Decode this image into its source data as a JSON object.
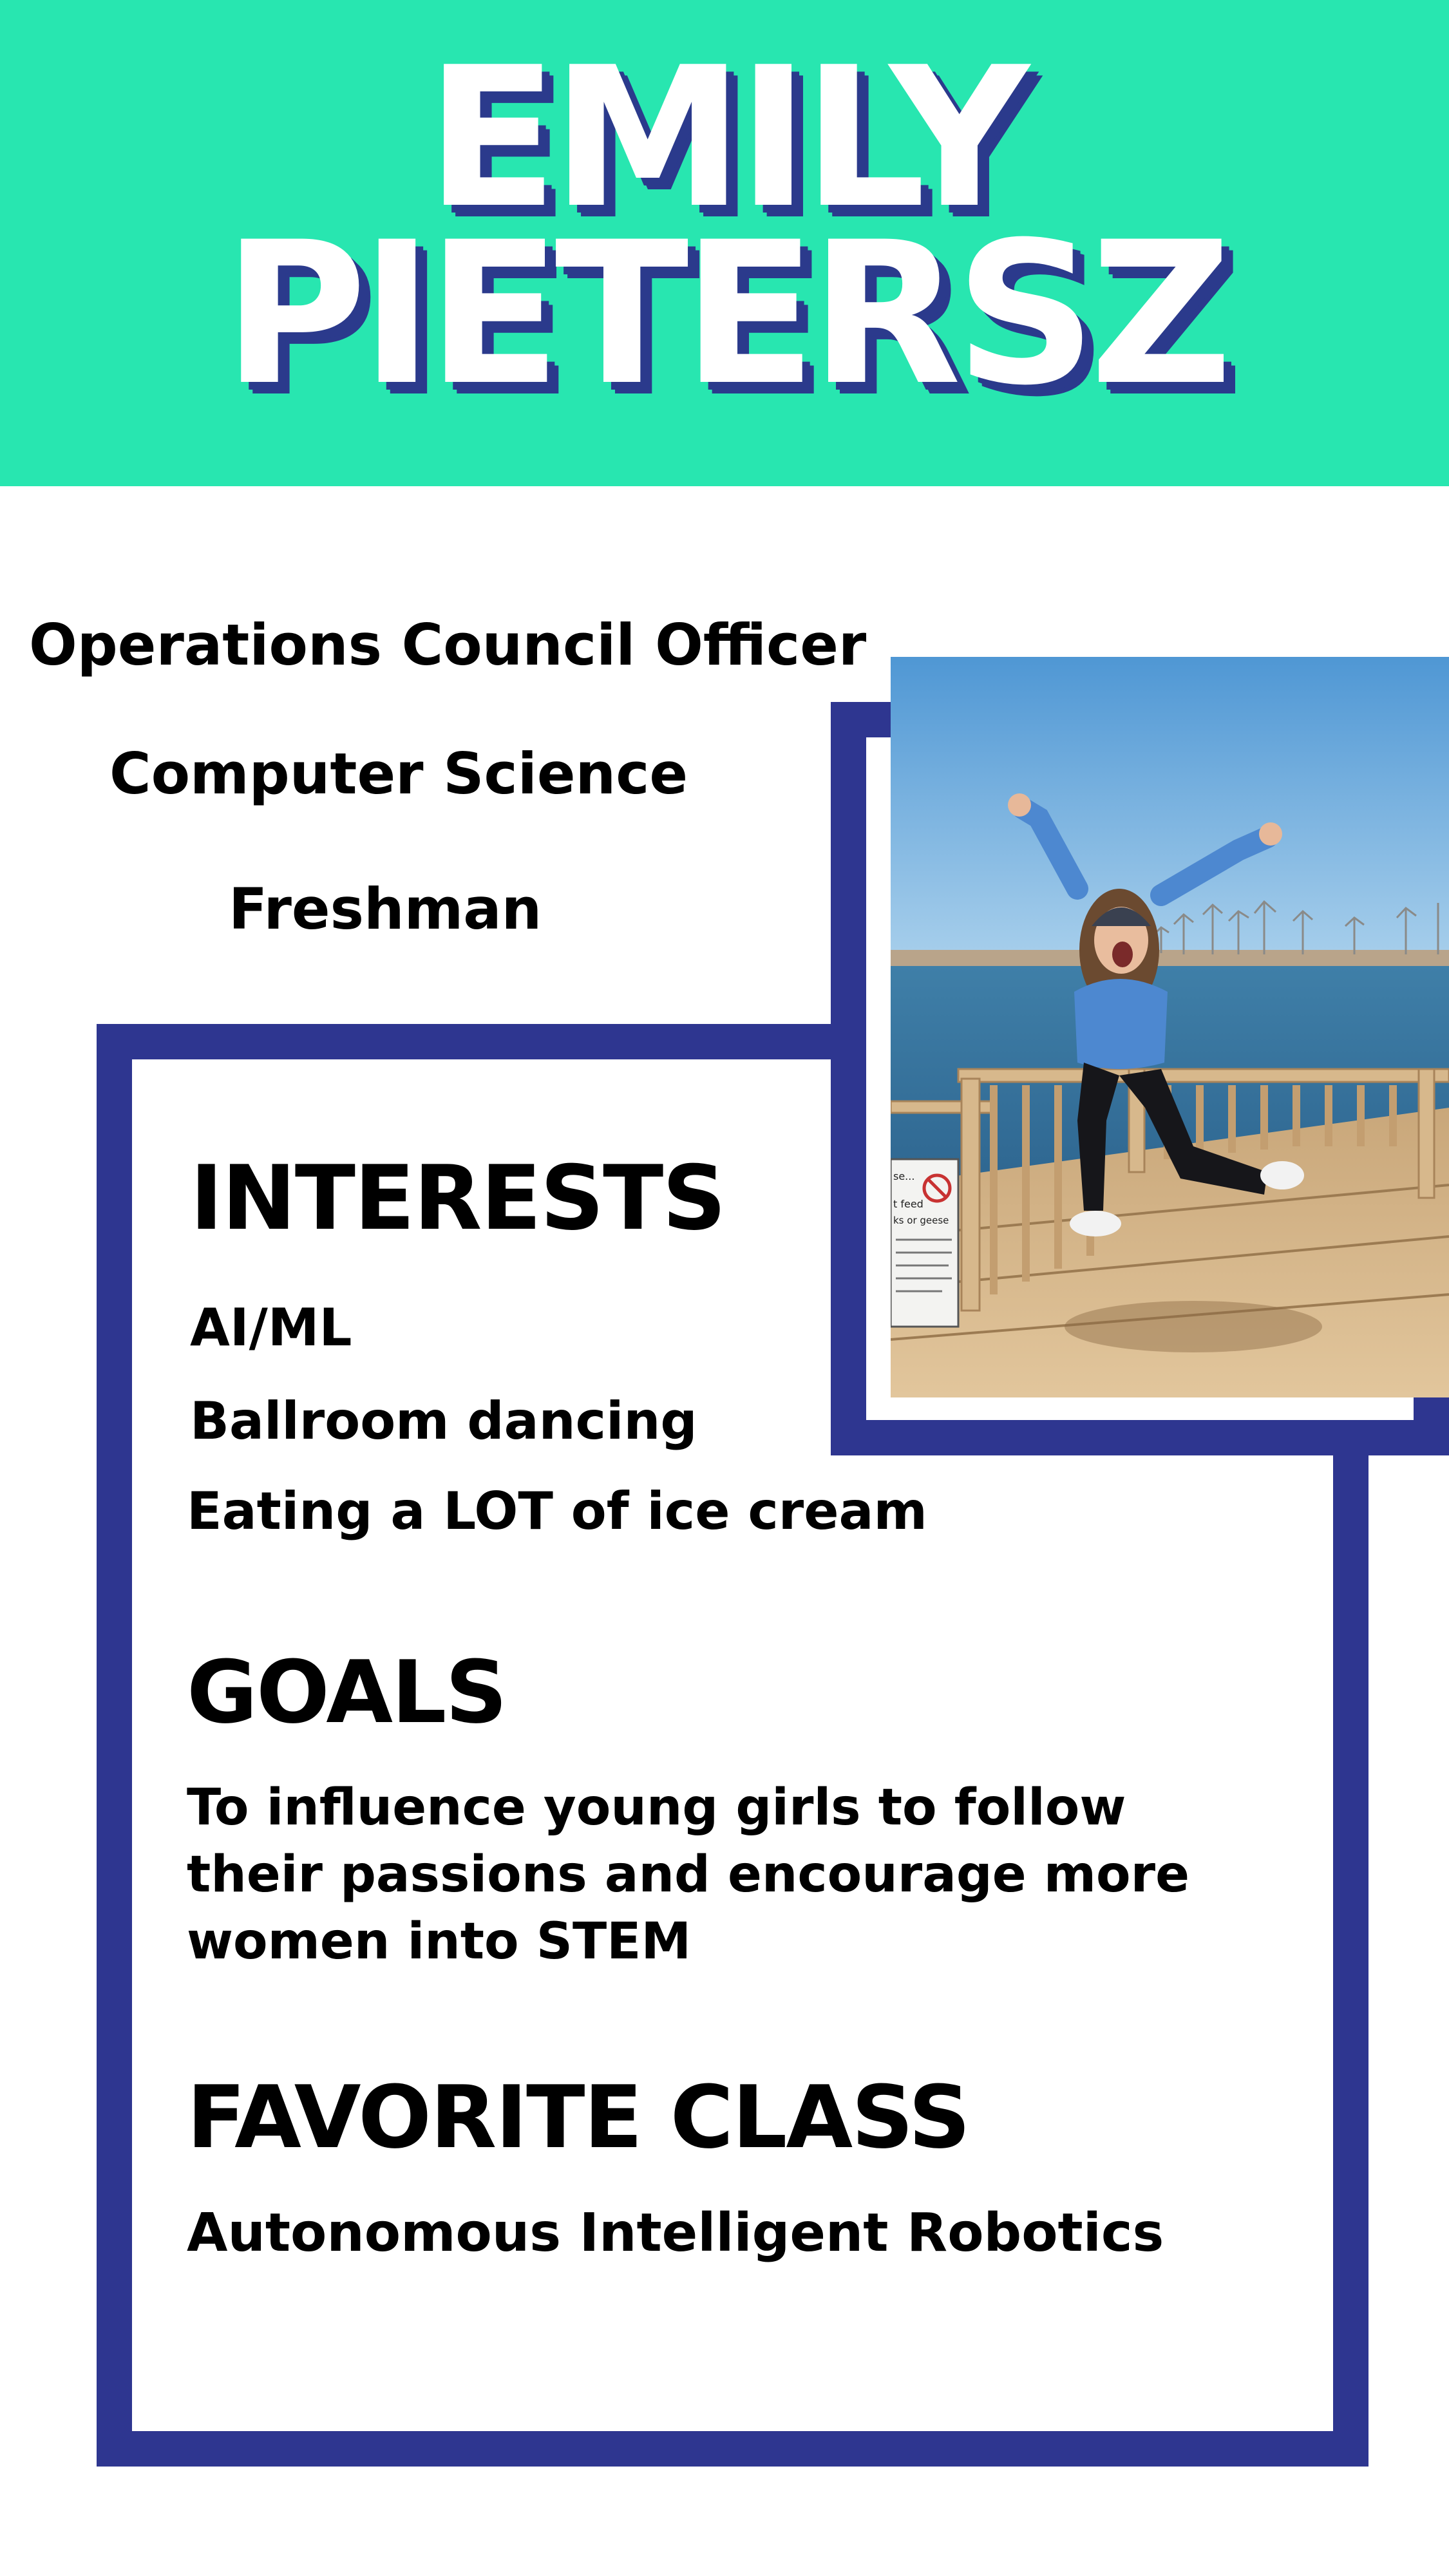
{
  "header": {
    "first_name": "EMILY",
    "last_name": "PIETERSZ",
    "background_color": "#28e6b0",
    "shadow_color": "#2b3a8c"
  },
  "profile": {
    "role": "Operations Council Officer",
    "major": "Computer Science",
    "year": "Freshman"
  },
  "interests": {
    "heading": "INTERESTS",
    "items": [
      "AI/ML",
      "Ballroom dancing",
      "Eating a LOT of ice cream"
    ]
  },
  "goals": {
    "heading": "GOALS",
    "text": "To influence young girls to follow their passions and encourage more women into STEM"
  },
  "favorite_class": {
    "heading": "FAVORITE CLASS",
    "text": "Autonomous Intelligent Robotics"
  },
  "colors": {
    "frame": "#2e3690",
    "text": "#000000"
  },
  "photo": {
    "description_icon": "photo-person-jumping-on-dock",
    "sign_text": [
      "se...",
      "t feed",
      "ks or geese"
    ]
  }
}
